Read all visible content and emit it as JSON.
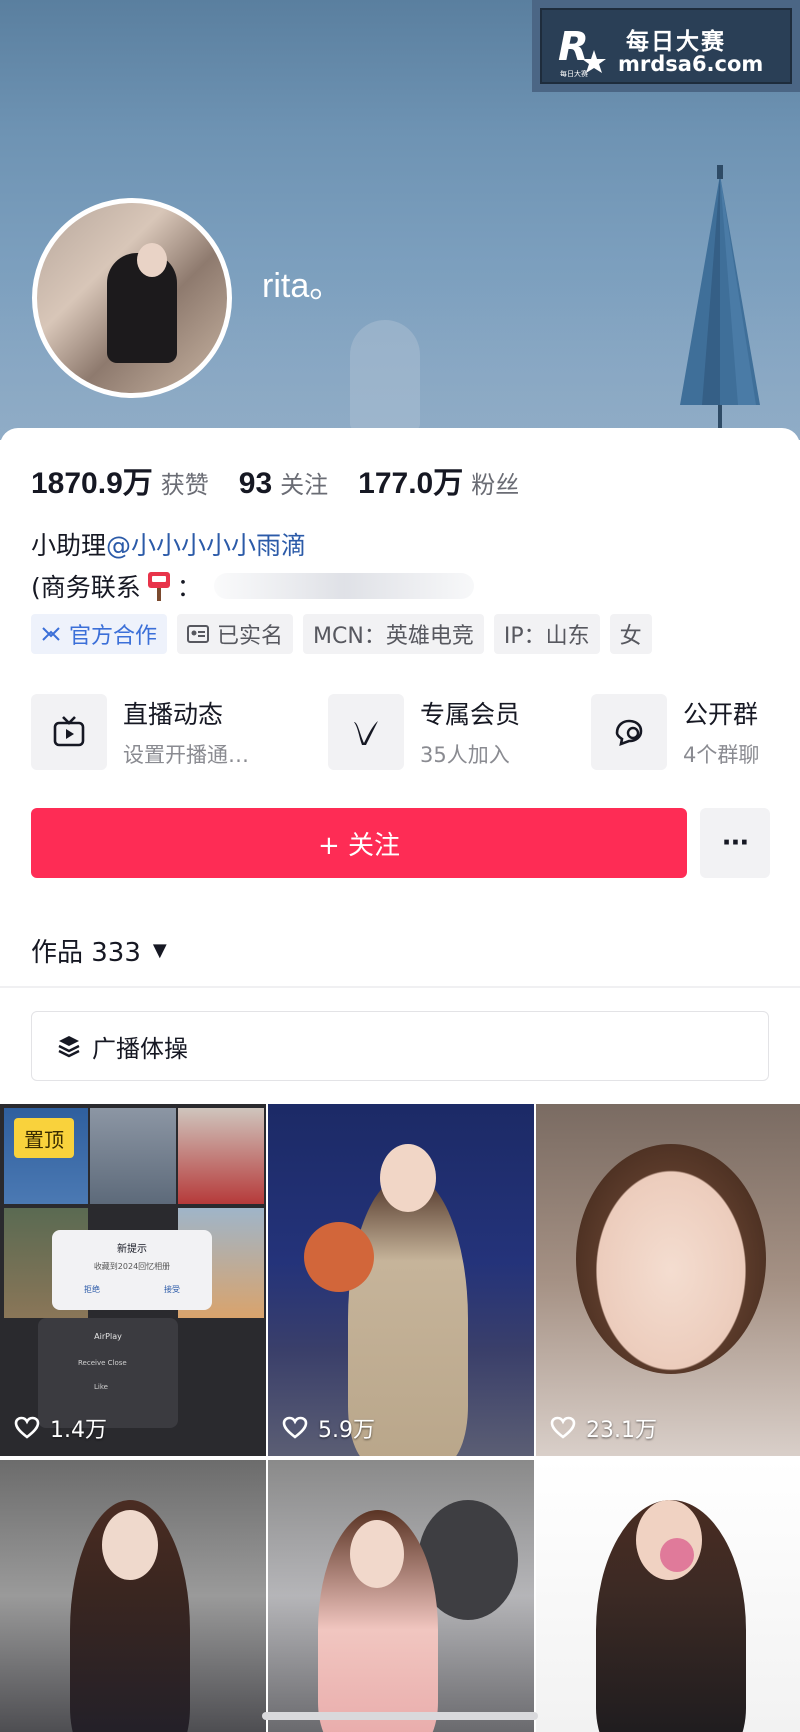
{
  "watermark": {
    "logo_text": "每日大赛",
    "line1": "每日大赛",
    "line2": "mrdsa6.com"
  },
  "profile": {
    "username": "rita。",
    "stats": [
      {
        "value": "1870.9万",
        "label": "获赞"
      },
      {
        "value": "93",
        "label": "关注"
      },
      {
        "value": "177.0万",
        "label": "粉丝"
      }
    ],
    "bio_line1_prefix": "小助理",
    "bio_line1_mention": "@小小小小小雨滴",
    "bio_line2": "(商务联系",
    "bio_line2_suffix": "：",
    "tags": [
      {
        "label": "官方合作",
        "icon": "official-icon"
      },
      {
        "label": "已实名",
        "icon": "id-card-icon"
      },
      {
        "label": "MCN：英雄电竞"
      },
      {
        "label": "IP：山东"
      },
      {
        "label": "女"
      }
    ]
  },
  "features": [
    {
      "title": "直播动态",
      "subtitle": "设置开播通…",
      "icon": "tv-icon"
    },
    {
      "title": "专属会员",
      "subtitle": "35人加入",
      "icon": "v-icon"
    },
    {
      "title": "公开群",
      "subtitle": "4个群聊",
      "icon": "chat-icon"
    }
  ],
  "actions": {
    "follow_label": "+ 关注",
    "more_label": "···"
  },
  "works": {
    "label": "作品 333",
    "caret": "▼"
  },
  "playlist": {
    "label": "广播体操",
    "icon": "layers-icon"
  },
  "grid": {
    "pin_label": "置顶",
    "screenshot_texts": {
      "dialog_title": "新提示",
      "dialog_body": "收藏到2024回忆相册",
      "deny": "拒绝",
      "accept": "接受",
      "airplay": "AirPlay",
      "menu1": "Receive Close",
      "menu2": "Like"
    },
    "videos": [
      {
        "likes": "1.4万"
      },
      {
        "likes": "5.9万"
      },
      {
        "likes": "23.1万"
      },
      {
        "likes": ""
      },
      {
        "likes": ""
      },
      {
        "likes": ""
      }
    ]
  },
  "colors": {
    "accent": "#fe2c55",
    "mention": "#2b5aa8",
    "official": "#3b6fd8",
    "pin": "#f9d23c"
  }
}
